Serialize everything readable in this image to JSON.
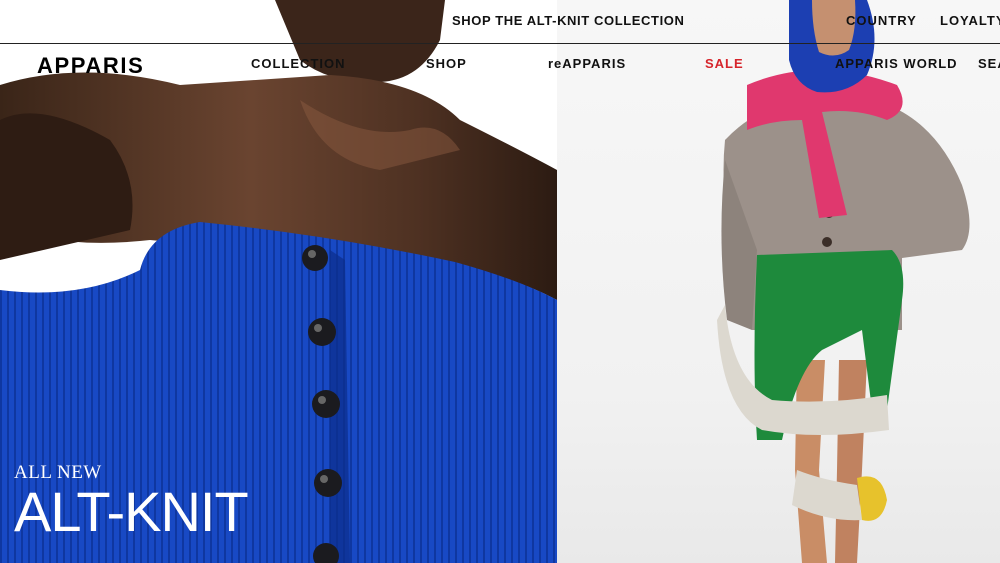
{
  "top_bar": {
    "promo": "SHOP THE ALT-KNIT COLLECTION",
    "country": "COUNTRY",
    "loyalty": "LOYALTY"
  },
  "header": {
    "logo": "APPARIS",
    "nav": [
      {
        "label": "COLLECTION"
      },
      {
        "label": "SHOP"
      },
      {
        "label": "reAPPARIS"
      },
      {
        "label": "SALE"
      },
      {
        "label": "APPARIS WORLD"
      },
      {
        "label": "SEA"
      }
    ]
  },
  "hero": {
    "eyebrow": "ALL NEW",
    "headline": "ALT-KNIT"
  },
  "colors": {
    "sale": "#d6242b",
    "knit_blue": "#1545c0",
    "text": "#111111"
  }
}
